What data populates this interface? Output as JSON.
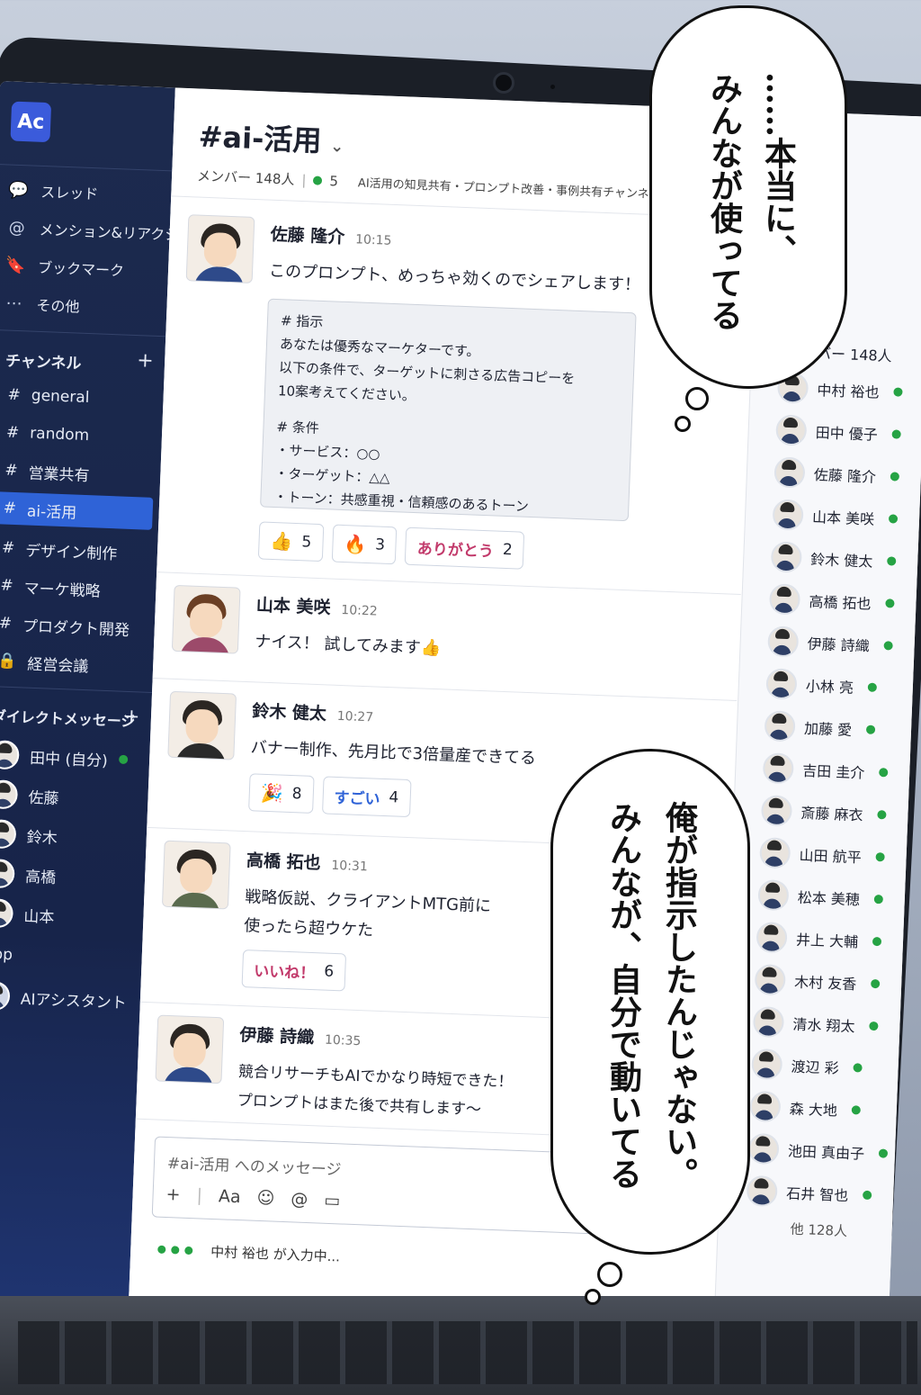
{
  "app": {
    "logo": "Ac"
  },
  "sidebar": {
    "top_items": [
      {
        "icon": "thread-icon",
        "label": "スレッド"
      },
      {
        "icon": "mention-icon",
        "label": "メンション&リアクション"
      },
      {
        "icon": "bookmark-icon",
        "label": "ブックマーク"
      },
      {
        "icon": "more-icon",
        "label": "その他"
      }
    ],
    "channels_heading": "チャンネル",
    "channels": [
      "general",
      "random",
      "営業共有",
      "ai-活用",
      "デザイン制作",
      "マーケ戦略",
      "プロダクト開発",
      "経営会議"
    ],
    "active_channel": "ai-活用",
    "locked_channel": "経営会議",
    "dm_heading": "ダイレクトメッセージ",
    "dms": [
      "田中 (自分)",
      "佐藤",
      "鈴木",
      "高橋",
      "山本"
    ],
    "app_heading": "App",
    "app_item": "AIアシスタント"
  },
  "channel": {
    "title": "#ai-活用",
    "members_label": "メンバー 148人",
    "online_count": "5",
    "description": "AI活用の知見共有・プロンプト改善・事例共有チャンネル"
  },
  "messages": [
    {
      "name": "佐藤 隆介",
      "time": "10:15",
      "text": "このプロンプト、めっちゃ効くのでシェアします！",
      "code": [
        "# 指示",
        "あなたは優秀なマーケターです。",
        "以下の条件で、ターゲットに刺さる広告コピーを",
        "10案考えてください。",
        "",
        "# 条件",
        "・サービス：○○",
        "・ターゲット：△△",
        "・トーン：共感重視・信頼感のあるトーン"
      ],
      "reactions": [
        {
          "emoji": "👍",
          "count": "5"
        },
        {
          "emoji": "🔥",
          "count": "3"
        },
        {
          "word": "ありがとう",
          "count": "2",
          "color": "#c23a6b"
        }
      ]
    },
    {
      "name": "山本 美咲",
      "time": "10:22",
      "text": "ナイス！ 試してみます👍"
    },
    {
      "name": "鈴木 健太",
      "time": "10:27",
      "text": "バナー制作、先月比で3倍量産できてる",
      "reactions": [
        {
          "emoji": "🎉",
          "count": "8"
        },
        {
          "word": "すごい",
          "count": "4",
          "color": "#2f63d7"
        }
      ]
    },
    {
      "name": "高橋 拓也",
      "time": "10:31",
      "lines": [
        "戦略仮説、クライアントMTG前に",
        "使ったら超ウケた"
      ],
      "reactions": [
        {
          "word": "いいね！",
          "count": "6",
          "color": "#c23a6b"
        }
      ]
    },
    {
      "name": "伊藤 詩織",
      "time": "10:35",
      "lines": [
        "競合リサーチもAIでかなり時短できた！",
        "プロンプトはまた後で共有します〜"
      ]
    }
  ],
  "composer": {
    "placeholder": "#ai-活用 へのメッセージ",
    "tools": [
      "+",
      "Aa",
      "☺",
      "@",
      "▭"
    ]
  },
  "typing": "中村 裕也 が入力中...",
  "members": {
    "heading": "メンバー 148人",
    "list": [
      "中村 裕也",
      "田中 優子",
      "佐藤 隆介",
      "山本 美咲",
      "鈴木 健太",
      "高橋 拓也",
      "伊藤 詩織",
      "小林 亮",
      "加藤 愛",
      "吉田 圭介",
      "斎藤 麻衣",
      "山田 航平",
      "松本 美穂",
      "井上 大輔",
      "木村 友香",
      "清水 翔太",
      "渡辺 彩",
      "森 大地",
      "池田 真由子",
      "石井 智也"
    ],
    "more": "他 128人"
  },
  "thoughts": {
    "top": [
      "……本当に、",
      "みんなが使ってる"
    ],
    "bottom": [
      "俺が指示したんじゃない。",
      "みんなが、自分で動いてる"
    ]
  },
  "colors": {
    "sidebar": "#1c2a4e",
    "active": "#2f63d7",
    "online": "#26a344"
  }
}
